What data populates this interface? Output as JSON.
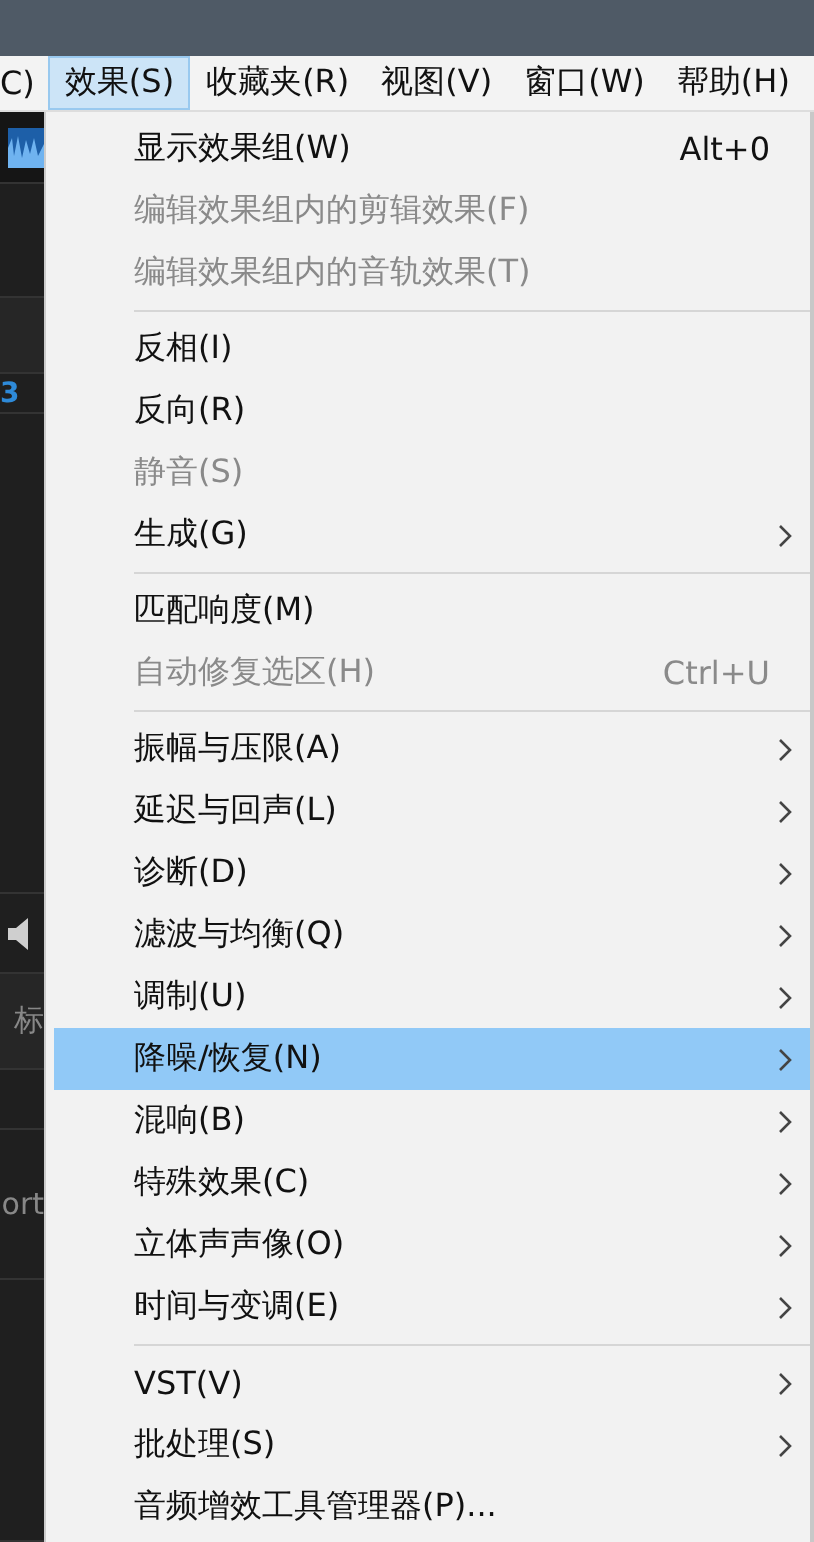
{
  "menubar": [
    {
      "label": "C)",
      "selected": false
    },
    {
      "label": "效果(S)",
      "selected": true
    },
    {
      "label": "收藏夹(R)",
      "selected": false
    },
    {
      "label": "视图(V)",
      "selected": false
    },
    {
      "label": "窗口(W)",
      "selected": false
    },
    {
      "label": "帮助(H)",
      "selected": false
    }
  ],
  "background_panel": {
    "texts": [
      {
        "text": "3",
        "kind": "value"
      },
      {
        "text": "标",
        "kind": "label"
      },
      {
        "text": "ort",
        "kind": "label"
      }
    ]
  },
  "menu": [
    {
      "kind": "item",
      "label": "显示效果组(W)",
      "shortcut": "Alt+0",
      "disabled": false,
      "submenu": false,
      "selected": false
    },
    {
      "kind": "item",
      "label": "编辑效果组内的剪辑效果(F)",
      "disabled": true,
      "submenu": false,
      "selected": false
    },
    {
      "kind": "item",
      "label": "编辑效果组内的音轨效果(T)",
      "disabled": true,
      "submenu": false,
      "selected": false
    },
    {
      "kind": "separator"
    },
    {
      "kind": "item",
      "label": "反相(I)",
      "disabled": false,
      "submenu": false,
      "selected": false
    },
    {
      "kind": "item",
      "label": "反向(R)",
      "disabled": false,
      "submenu": false,
      "selected": false
    },
    {
      "kind": "item",
      "label": "静音(S)",
      "disabled": true,
      "submenu": false,
      "selected": false
    },
    {
      "kind": "item",
      "label": "生成(G)",
      "disabled": false,
      "submenu": true,
      "selected": false
    },
    {
      "kind": "separator"
    },
    {
      "kind": "item",
      "label": "匹配响度(M)",
      "disabled": false,
      "submenu": false,
      "selected": false
    },
    {
      "kind": "item",
      "label": "自动修复选区(H)",
      "shortcut": "Ctrl+U",
      "disabled": true,
      "submenu": false,
      "selected": false
    },
    {
      "kind": "separator"
    },
    {
      "kind": "item",
      "label": "振幅与压限(A)",
      "disabled": false,
      "submenu": true,
      "selected": false
    },
    {
      "kind": "item",
      "label": "延迟与回声(L)",
      "disabled": false,
      "submenu": true,
      "selected": false
    },
    {
      "kind": "item",
      "label": "诊断(D)",
      "disabled": false,
      "submenu": true,
      "selected": false
    },
    {
      "kind": "item",
      "label": "滤波与均衡(Q)",
      "disabled": false,
      "submenu": true,
      "selected": false
    },
    {
      "kind": "item",
      "label": "调制(U)",
      "disabled": false,
      "submenu": true,
      "selected": false
    },
    {
      "kind": "item",
      "label": "降噪/恢复(N)",
      "disabled": false,
      "submenu": true,
      "selected": true
    },
    {
      "kind": "item",
      "label": "混响(B)",
      "disabled": false,
      "submenu": true,
      "selected": false
    },
    {
      "kind": "item",
      "label": "特殊效果(C)",
      "disabled": false,
      "submenu": true,
      "selected": false
    },
    {
      "kind": "item",
      "label": "立体声声像(O)",
      "disabled": false,
      "submenu": true,
      "selected": false
    },
    {
      "kind": "item",
      "label": "时间与变调(E)",
      "disabled": false,
      "submenu": true,
      "selected": false
    },
    {
      "kind": "separator"
    },
    {
      "kind": "item",
      "label": "VST(V)",
      "disabled": false,
      "submenu": true,
      "selected": false
    },
    {
      "kind": "item",
      "label": "批处理(S)",
      "disabled": false,
      "submenu": true,
      "selected": false
    },
    {
      "kind": "item",
      "label": "音频增效工具管理器(P)...",
      "disabled": false,
      "submenu": false,
      "selected": false
    }
  ]
}
